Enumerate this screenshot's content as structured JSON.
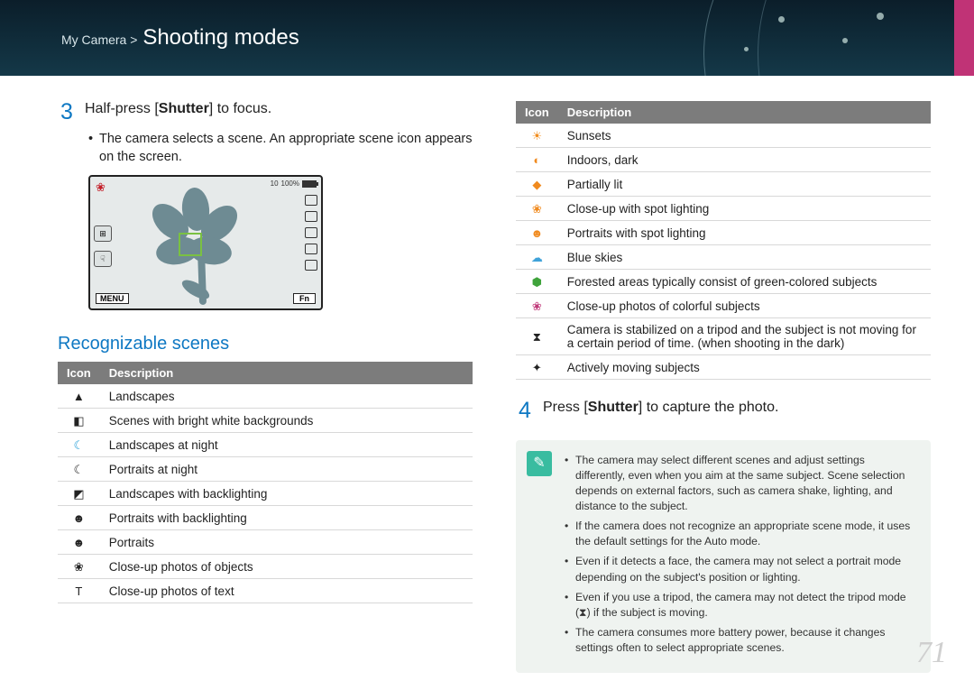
{
  "breadcrumb": {
    "path": "My Camera >",
    "title": "Shooting modes"
  },
  "step3": {
    "num": "3",
    "text_pre": "Half-press [",
    "text_bold": "Shutter",
    "text_post": "] to focus.",
    "sub": "The camera selects a scene. An appropriate scene icon appears on the screen."
  },
  "lcd": {
    "count": "10",
    "pct": "100%",
    "menu": "MENU",
    "fn": "Fn"
  },
  "section1": "Recognizable scenes",
  "th_icon": "Icon",
  "th_desc": "Description",
  "table1": [
    {
      "icon": "▲",
      "color": "#222",
      "desc": "Landscapes"
    },
    {
      "icon": "◧",
      "color": "#222",
      "desc": "Scenes with bright white backgrounds"
    },
    {
      "icon": "☾",
      "color": "#1e9bd6",
      "desc": "Landscapes at night"
    },
    {
      "icon": "☾",
      "color": "#222",
      "desc": "Portraits at night"
    },
    {
      "icon": "◩",
      "color": "#222",
      "desc": "Landscapes with backlighting"
    },
    {
      "icon": "☻",
      "color": "#222",
      "desc": "Portraits with backlighting"
    },
    {
      "icon": "☻",
      "color": "#222",
      "desc": "Portraits"
    },
    {
      "icon": "❀",
      "color": "#222",
      "desc": "Close-up photos of objects"
    },
    {
      "icon": "T",
      "color": "#222",
      "desc": "Close-up photos of text"
    }
  ],
  "table2": [
    {
      "icon": "☀",
      "color": "#f28c1c",
      "desc": "Sunsets"
    },
    {
      "icon": "◐",
      "color": "#f08a1e",
      "desc": "Indoors, dark"
    },
    {
      "icon": "◆",
      "color": "#f08a1e",
      "desc": "Partially lit"
    },
    {
      "icon": "❀",
      "color": "#f08a1e",
      "desc": "Close-up with spot lighting"
    },
    {
      "icon": "☻",
      "color": "#f08a1e",
      "desc": "Portraits with spot lighting"
    },
    {
      "icon": "☁",
      "color": "#3fa2d9",
      "desc": "Blue skies"
    },
    {
      "icon": "⬢",
      "color": "#3fa33b",
      "desc": "Forested areas typically consist of green-colored subjects"
    },
    {
      "icon": "❀",
      "color": "#c13a7a",
      "desc": "Close-up photos of colorful subjects"
    },
    {
      "icon": "⧗",
      "color": "#222",
      "desc": "Camera is stabilized on a tripod and the subject is not moving for a certain period of time. (when shooting in the dark)"
    },
    {
      "icon": "✦",
      "color": "#222",
      "desc": "Actively moving subjects"
    }
  ],
  "step4": {
    "num": "4",
    "text_pre": "Press [",
    "text_bold": "Shutter",
    "text_post": "] to capture the photo."
  },
  "notes": [
    "The camera may select different scenes and adjust settings differently, even when you aim at the same subject. Scene selection depends on external factors, such as camera shake, lighting, and distance to the subject.",
    "If the camera does not recognize an appropriate scene mode, it uses the default settings for the Auto mode.",
    "Even if it detects a face, the camera may not select a portrait mode depending on the subject's position or lighting.",
    "Even if you use a tripod, the camera may not detect the tripod mode (⧗) if the subject is moving.",
    "The camera consumes more battery power, because it changes settings often to select appropriate scenes."
  ],
  "page": "71"
}
